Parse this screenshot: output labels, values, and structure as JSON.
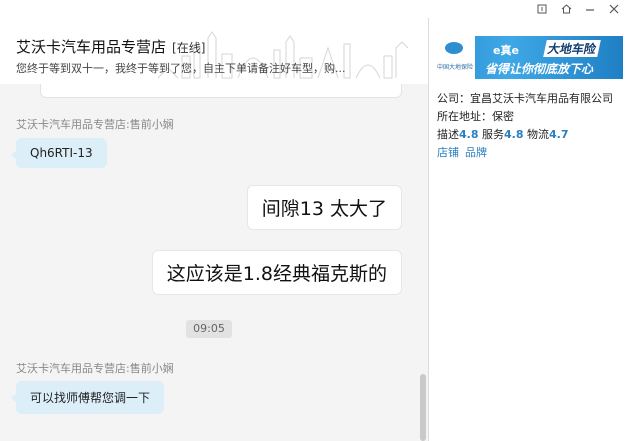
{
  "window": {
    "controls": [
      "restore-down",
      "home",
      "minimize",
      "close"
    ]
  },
  "header": {
    "shop_name": "艾沃卡汽车用品专营店",
    "status": "[在线]",
    "signature": "您终于等到双十一，我终于等到了您，自主下单请备注好车型，购..."
  },
  "chat": {
    "top_partial": "(部分可见的消息)",
    "messages": [
      {
        "sender": "艾沃卡汽车用品专营店:售前小娴",
        "text": "Qh6RTI-13",
        "direction": "in"
      },
      {
        "text": "间隙13 太大了",
        "direction": "out"
      },
      {
        "text": "这应该是1.8经典福克斯的",
        "direction": "out"
      },
      {
        "time": "09:05"
      },
      {
        "sender": "艾沃卡汽车用品专营店:售前小娴",
        "text": "可以找师傅帮您调一下",
        "direction": "in"
      }
    ]
  },
  "panel": {
    "banner": {
      "logo_text": "中国大地保险",
      "line1": "e真e",
      "line2": "大地车险",
      "line3": "省得让你彻底放下心",
      "colors": {
        "bg": "#2a8fd0",
        "accent": "#103d6e"
      }
    },
    "company_label": "公司：宜昌艾沃卡汽车用品有限公司",
    "address_label": "所在地址：保密",
    "describe_label": "描述",
    "describe_score": "4.8",
    "service_label": "服务",
    "service_score": "4.8",
    "logistics_label": "物流",
    "logistics_score": "4.7",
    "link_shop": "店铺",
    "link_brand": "品牌"
  }
}
